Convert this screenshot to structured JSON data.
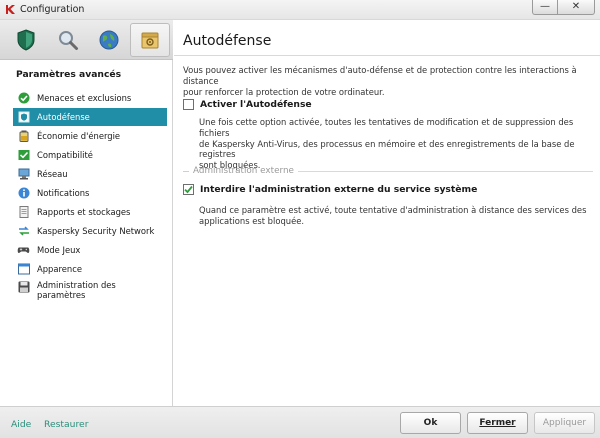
{
  "window": {
    "title": "Configuration",
    "minimize_glyph": "—",
    "close_glyph": "✕"
  },
  "sidebar": {
    "top_icons": [
      {
        "icon": "shield-icon",
        "active": false
      },
      {
        "icon": "search-icon",
        "active": false
      },
      {
        "icon": "globe-icon",
        "active": false
      },
      {
        "icon": "settings-box-icon",
        "active": true
      }
    ],
    "title": "Paramètres avancés",
    "items": [
      {
        "label": "Menaces et exclusions",
        "icon": "green-check-icon",
        "active": false
      },
      {
        "label": "Autodéfense",
        "icon": "self-defense-icon",
        "active": true
      },
      {
        "label": "Économie d'énergie",
        "icon": "battery-icon",
        "active": false
      },
      {
        "label": "Compatibilité",
        "icon": "compatibility-icon",
        "active": false
      },
      {
        "label": "Réseau",
        "icon": "network-icon",
        "active": false
      },
      {
        "label": "Notifications",
        "icon": "info-icon",
        "active": false
      },
      {
        "label": "Rapports et stockages",
        "icon": "report-icon",
        "active": false
      },
      {
        "label": "Kaspersky Security Network",
        "icon": "ksn-arrows-icon",
        "active": false
      },
      {
        "label": "Mode Jeux",
        "icon": "gamepad-icon",
        "active": false
      },
      {
        "label": "Apparence",
        "icon": "appearance-icon",
        "active": false
      },
      {
        "label_line1": "Administration des",
        "label_line2": "paramètres",
        "icon": "floppy-icon",
        "active": false
      }
    ]
  },
  "content": {
    "title": "Autodéfense",
    "intro_line1": "Vous pouvez activer les mécanismes d'auto-défense et de protection contre les interactions à distance",
    "intro_line2": "pour renforcer la protection de votre ordinateur.",
    "option1": {
      "label": "Activer l'Autodéfense",
      "checked": false,
      "desc_line1": "Une fois cette option activée, toutes les tentatives de modification et de suppression des fichiers",
      "desc_line2": "de Kaspersky Anti-Virus, des processus en mémoire et des enregistrements de la base de registres",
      "desc_line3": "sont bloquées."
    },
    "section_title": "Administration externe",
    "option2": {
      "label": "Interdire l'administration externe du service système",
      "checked": true,
      "desc_line1": "Quand ce paramètre est activé, toute tentative d'administration à distance des services des",
      "desc_line2": "applications est bloquée."
    }
  },
  "footer": {
    "help": "Aide",
    "restore": "Restaurer",
    "ok": "Ok",
    "close": "Fermer",
    "apply": "Appliquer"
  },
  "colors": {
    "accent": "#1f8ea6",
    "link": "#2a8f7c",
    "check": "#2e9e3a"
  }
}
